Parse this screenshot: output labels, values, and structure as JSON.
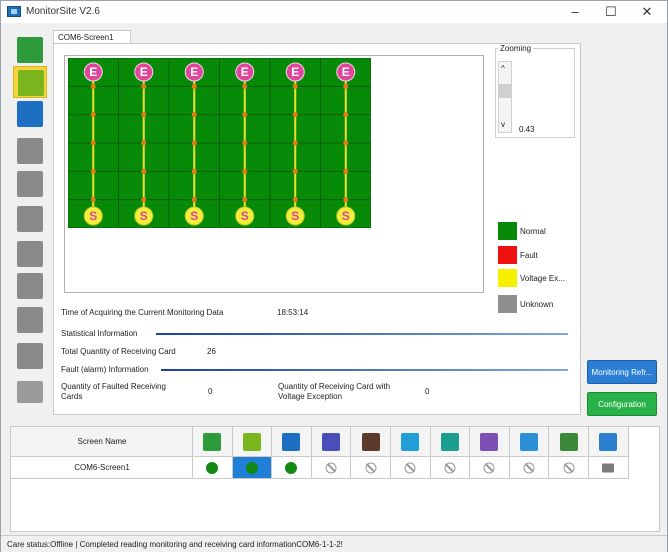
{
  "window": {
    "title": "MonitorSite V2.6",
    "minimize": "–",
    "maximize": "☐",
    "close": "✕"
  },
  "sidebar": {
    "items": [
      {
        "name": "receiving-card",
        "color": "#2e9b3b",
        "active": false
      },
      {
        "name": "monitoring-card",
        "color": "#7ab51d",
        "active": true
      },
      {
        "name": "temperature",
        "color": "#1d6fc2",
        "active": false
      },
      {
        "name": "humidity",
        "color": "#8a8a8a",
        "active": false
      },
      {
        "name": "smoke",
        "color": "#8a8a8a",
        "active": false
      },
      {
        "name": "fan",
        "color": "#8a8a8a",
        "active": false
      },
      {
        "name": "voltage",
        "color": "#8a8a8a",
        "active": false
      },
      {
        "name": "magnet",
        "color": "#8a8a8a",
        "active": false
      },
      {
        "name": "door",
        "color": "#8a8a8a",
        "active": false
      },
      {
        "name": "module",
        "color": "#8a8a8a",
        "active": false
      }
    ]
  },
  "tab": {
    "label": "COM6-Screen1"
  },
  "grid": {
    "columns": 6,
    "rows": 6,
    "top_label": "E",
    "bottom_label": "S",
    "cell_color": "#078a07",
    "line_color": "#f0e02a",
    "marker_color": "#e0459c"
  },
  "zooming": {
    "label": "Zooming",
    "value": "0.43",
    "up": "^",
    "down": "v"
  },
  "legend": [
    {
      "label": "Normal",
      "color": "#078a07"
    },
    {
      "label": "Fault",
      "color": "#ef1010"
    },
    {
      "label": "Voltage Ex...",
      "color": "#f4f000"
    },
    {
      "label": "Unknown",
      "color": "#8f8f8f"
    }
  ],
  "info": {
    "time_label": "Time of Acquiring the Current Monitoring Data",
    "time_value": "18:53:14",
    "stat_title": "Statistical Information",
    "total_label": "Total Quantity of Receiving Card",
    "total_value": "26",
    "fault_title": "Fault (alarm) Information",
    "faulted_label_1": "Quantity of Faulted Receiving",
    "faulted_label_2": "Cards",
    "faulted_value": "0",
    "voltage_label_1": "Quantity of Receiving Card with",
    "voltage_label_2": "Voltage Exception",
    "voltage_value": "0"
  },
  "buttons": {
    "monitoring_refresh": "Monitoring Refr...",
    "configuration": "Configuration"
  },
  "table": {
    "header_label": "Screen Name",
    "row_name": "COM6-Screen1",
    "columns": [
      {
        "icon": "receiving-card-icon",
        "color": "#2e9b3b",
        "state": "ok"
      },
      {
        "icon": "monitoring-card-icon",
        "color": "#7ab51d",
        "state": "ok-selected"
      },
      {
        "icon": "temperature-icon",
        "color": "#1d6fc2",
        "state": "ok"
      },
      {
        "icon": "humidity-icon",
        "color": "#4a4fb8",
        "state": "na"
      },
      {
        "icon": "smoke-icon",
        "color": "#5a3a2a",
        "state": "na"
      },
      {
        "icon": "fan-icon",
        "color": "#1f9fd6",
        "state": "na"
      },
      {
        "icon": "voltage-icon",
        "color": "#1b9e8f",
        "state": "na"
      },
      {
        "icon": "magnet-icon",
        "color": "#7e4fb5",
        "state": "na"
      },
      {
        "icon": "door-icon",
        "color": "#2d8fd6",
        "state": "na"
      },
      {
        "icon": "module-icon",
        "color": "#3a8a3a",
        "state": "na"
      },
      {
        "icon": "globe-icon",
        "color": "#2a7fd0",
        "state": "monitor"
      }
    ]
  },
  "status": {
    "text": "Care status:Offline  |  Completed reading monitoring and receiving card informationCOM6-1-1-2!"
  }
}
